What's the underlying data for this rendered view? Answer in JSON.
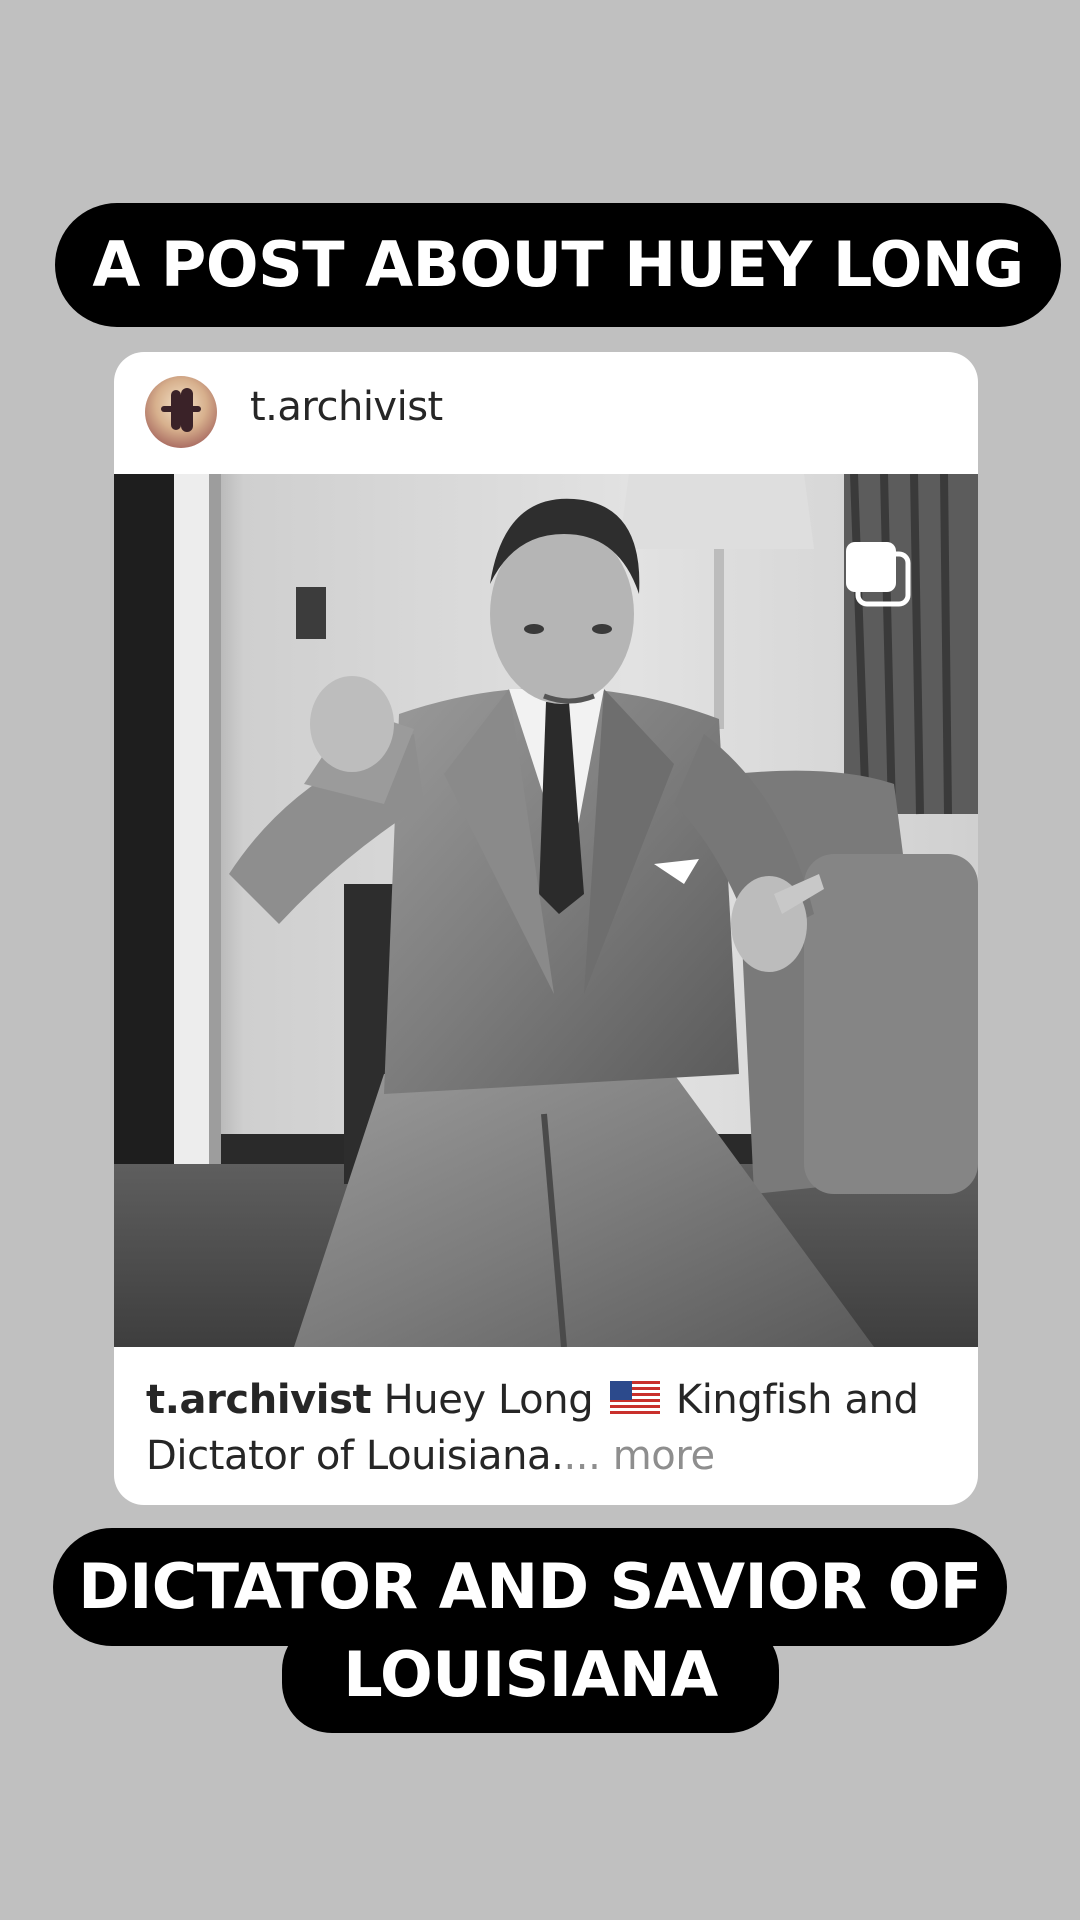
{
  "top_banner": {
    "text": "A POST ABOUT HUEY LONG"
  },
  "post": {
    "username": "t.archivist",
    "caption": {
      "username": "t.archivist",
      "text_before_flag": "Huey Long",
      "flag_icon": "us-flag-icon",
      "text_after_flag": "Kingfish and",
      "text_line2": "Dictator of Louisiana.",
      "ellipsis": "...",
      "more_label": "more"
    },
    "photo_icon": "multiple-images-icon"
  },
  "bottom_banner": {
    "line1": "DICTATOR AND SAVIOR OF",
    "line2": "LOUISIANA"
  },
  "colors": {
    "background": "#c0c0c0",
    "banner": "#000000",
    "banner_text": "#ffffff",
    "card": "#ffffff",
    "more_text": "#8e8e8e"
  }
}
